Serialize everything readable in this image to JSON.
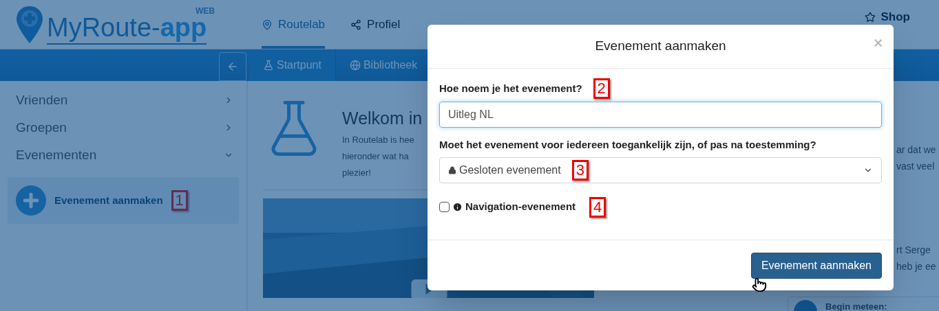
{
  "header": {
    "logo": {
      "text": "MyRoute-",
      "accent": "app",
      "badge": "WEB"
    },
    "nav": [
      {
        "label": "Routelab",
        "selected": true
      },
      {
        "label": "Profiel",
        "selected": false
      },
      {
        "label": "Shop",
        "selected": false
      }
    ]
  },
  "toolbar": {
    "tabs": [
      {
        "label": "Startpunt",
        "selected": true
      },
      {
        "label": "Bibliotheek",
        "selected": false
      }
    ]
  },
  "sidebar": {
    "items": [
      {
        "label": "Vrienden",
        "expanded": false
      },
      {
        "label": "Groepen",
        "expanded": false
      },
      {
        "label": "Evenementen",
        "expanded": true
      }
    ],
    "action": {
      "label": "Evenement aanmaken",
      "marker": "1"
    }
  },
  "main": {
    "title": "Welkom in",
    "intro_lines": [
      "In Routelab is hee",
      "hieronder wat ha",
      "plezier!"
    ],
    "right_lines": [
      "ar dat we",
      "vast veel"
    ],
    "side_lines": [
      "rt Serge",
      "heb je ee"
    ],
    "card_title": "Begin meteen:"
  },
  "modal": {
    "title": "Evenement aanmaken",
    "close": "×",
    "fields": [
      {
        "kind": "text",
        "label": "Hoe noem je het evenement?",
        "marker": "2",
        "value": "Uitleg NL"
      },
      {
        "kind": "select",
        "label": "Moet het evenement voor iedereen toegankelijk zijn, of pas na toestemming?",
        "marker": "3",
        "value": "Gesloten evenement"
      },
      {
        "kind": "checkbox",
        "label": "Navigation-evenement",
        "marker": "4",
        "checked": false
      }
    ],
    "submit": "Evenement aanmaken"
  }
}
